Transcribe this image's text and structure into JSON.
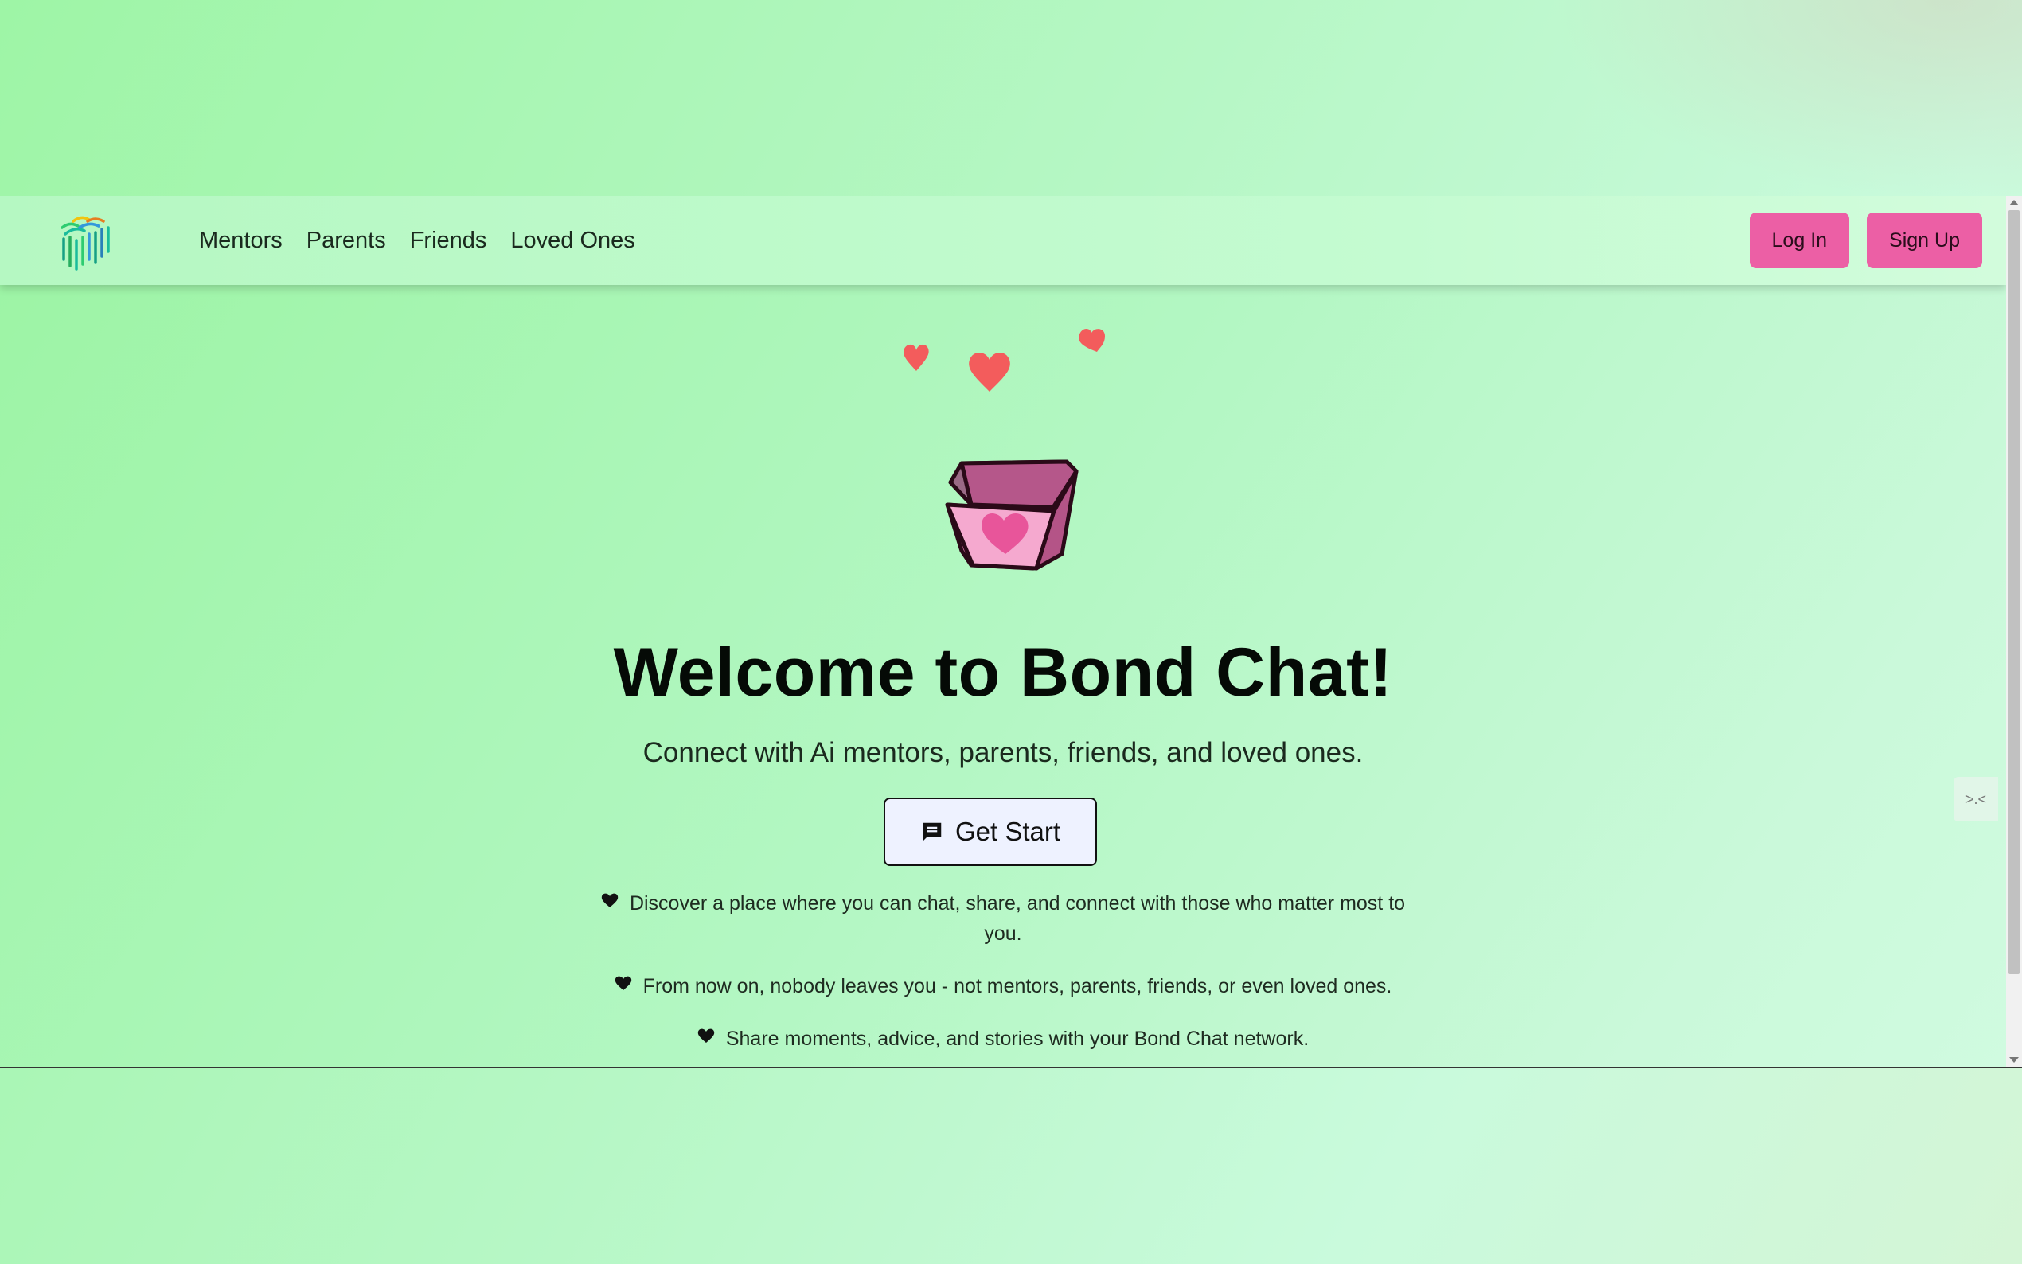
{
  "nav": {
    "links": [
      "Mentors",
      "Parents",
      "Friends",
      "Loved Ones"
    ],
    "login_label": "Log In",
    "signup_label": "Sign Up"
  },
  "hero": {
    "title": "Welcome to Bond Chat!",
    "subtitle": "Connect with Ai mentors, parents, friends, and loved ones.",
    "cta_label": "Get Start",
    "cta_icon": "chat-icon"
  },
  "features": [
    "Discover a place where you can chat, share, and connect with those who matter most to you.",
    "From now on, nobody leaves you - not mentors, parents, friends, or even loved ones.",
    "Share moments, advice, and stories with your Bond Chat network."
  ],
  "side_widget": {
    "label": ">.<"
  },
  "colors": {
    "accent_pink": "#ec5fa5",
    "heart_red": "#f35c5c",
    "background_green": "#b3f7c3"
  }
}
